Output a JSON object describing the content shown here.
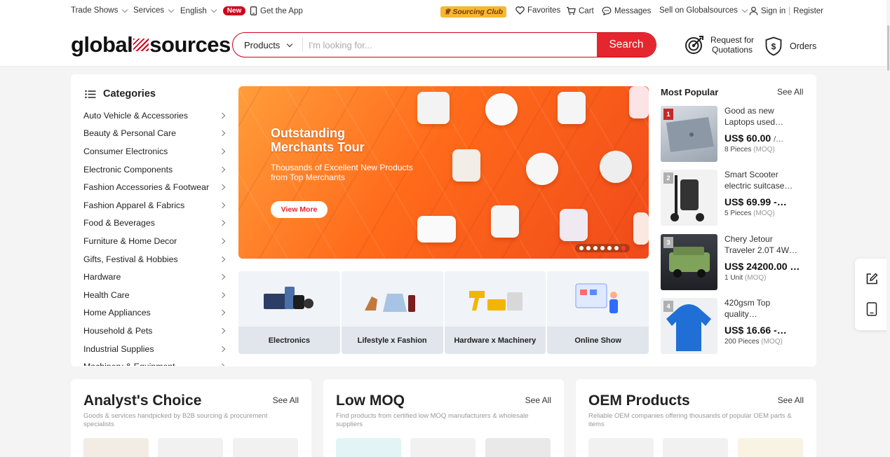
{
  "topbar": {
    "trade_shows": "Trade Shows",
    "services": "Services",
    "language": "English",
    "new_badge": "New",
    "get_app": "Get the App",
    "sourcing_club": "Sourcing Club",
    "favorites": "Favorites",
    "cart": "Cart",
    "messages": "Messages",
    "sell": "Sell on Globalsources",
    "sign_in": "Sign in",
    "separator": "|",
    "register": "Register"
  },
  "header": {
    "logo_left": "global",
    "logo_right": "sources",
    "search_scope": "Products",
    "search_placeholder": "I'm looking for...",
    "search_button": "Search",
    "rfq_line1": "Request for",
    "rfq_line2": "Quotations",
    "orders": "Orders"
  },
  "categories": {
    "title": "Categories",
    "items": [
      "Auto Vehicle & Accessories",
      "Beauty & Personal Care",
      "Consumer Electronics",
      "Electronic Components",
      "Fashion Accessories & Footwear",
      "Fashion Apparel & Fabrics",
      "Food & Beverages",
      "Furniture & Home Decor",
      "Gifts, Festival & Hobbies",
      "Hardware",
      "Health Care",
      "Home Appliances",
      "Household & Pets",
      "Industrial Supplies",
      "Machinery & Equipment"
    ]
  },
  "banner": {
    "title_line1": "Outstanding",
    "title_line2": "Merchants Tour",
    "subtitle_line1": "Thousands of Excellent New Products",
    "subtitle_line2": "from Top Merchants",
    "cta": "View More",
    "slide_count": 7,
    "active_slide": 7
  },
  "tiles": [
    {
      "label": "Electronics"
    },
    {
      "label": "Lifestyle x Fashion"
    },
    {
      "label": "Hardware x Machinery"
    },
    {
      "label": "Online Show"
    }
  ],
  "popular": {
    "title": "Most Popular",
    "see_all": "See All",
    "items": [
      {
        "rank": "1",
        "name": "Good as new Laptops used…",
        "price": "US$ 60.00",
        "price_suffix": "/…",
        "qty": "8 Pieces",
        "moq": "(MOQ)"
      },
      {
        "rank": "2",
        "name": "Smart Scooter electric suitcase…",
        "price": "US$ 69.99 -…",
        "price_suffix": "",
        "qty": "5 Pieces",
        "moq": "(MOQ)"
      },
      {
        "rank": "3",
        "name": "Chery Jetour Traveler 2.0T 4W…",
        "price": "US$ 24200.00 …",
        "price_suffix": "",
        "qty": "1 Unit",
        "moq": "(MOQ)"
      },
      {
        "rank": "4",
        "name": "420gsm Top quality…",
        "price": "US$ 16.66 -…",
        "price_suffix": "",
        "qty": "200 Pieces",
        "moq": "(MOQ)"
      }
    ]
  },
  "cards": [
    {
      "title": "Analyst's Choice",
      "see_all": "See All",
      "desc": "Goods & services handpicked by B2B sourcing & procurement specialists"
    },
    {
      "title": "Low MOQ",
      "see_all": "See All",
      "desc": "Find products from certified low MOQ manufacturers & wholesale suppliers"
    },
    {
      "title": "OEM Products",
      "see_all": "See All",
      "desc": "Reliable OEM companies offering thousands of popular OEM parts & items"
    }
  ],
  "colors": {
    "brand_red": "#e4262e",
    "new_badge": "#d0011b",
    "rank_1": "#c62828",
    "rank_other": "#b0b0b0"
  }
}
